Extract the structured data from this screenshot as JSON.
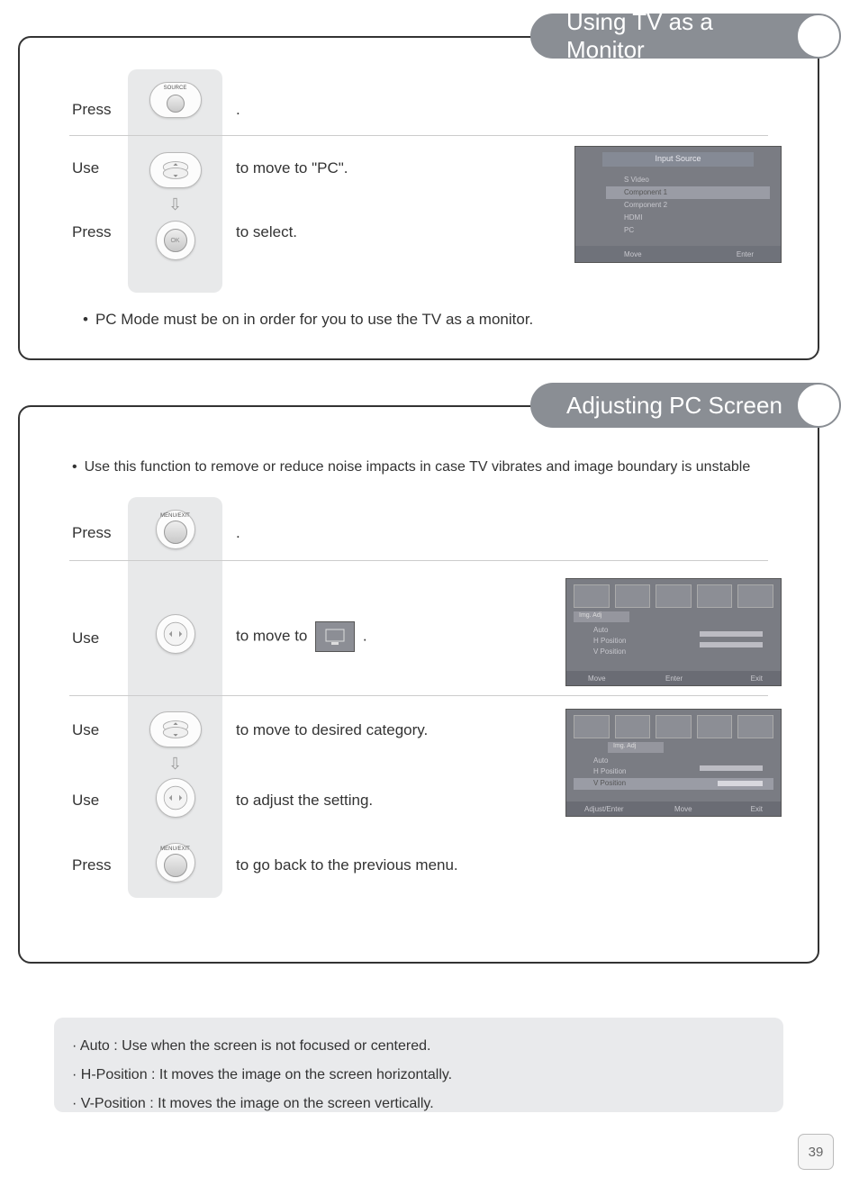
{
  "sections": {
    "s1": {
      "title": "Using TV as a Monitor",
      "rows": {
        "r1": {
          "action": "Press",
          "desc": ".",
          "button_label": "SOURCE"
        },
        "r2a": {
          "action": "Use",
          "desc": "to move to  \"PC\"."
        },
        "r2b": {
          "action": "Press",
          "desc": "to select.",
          "button_label": "OK"
        }
      },
      "note": "PC Mode must be on in order for you to use the TV as a monitor.",
      "osd": {
        "title": "Input Source",
        "items": [
          "S Video",
          "Component 1",
          "Component 2",
          "HDMI",
          "PC"
        ],
        "footer_left": "Move",
        "footer_right": "Enter"
      }
    },
    "s2": {
      "title": "Adjusting PC Screen",
      "intro": "Use this function to remove or reduce noise impacts in case TV vibrates and image boundary is unstable",
      "rows": {
        "r1": {
          "action": "Press",
          "desc": ".",
          "button_label": "MENU/EXIT"
        },
        "r2": {
          "action": "Use",
          "desc_pre": "to move to",
          "desc_post": "."
        },
        "r3": {
          "action": "Use",
          "desc": "to move to desired category."
        },
        "r4": {
          "action": "Use",
          "desc": "to adjust the setting."
        },
        "r5": {
          "action": "Press",
          "desc": "to go back to the previous menu.",
          "button_label": "MENU/EXIT"
        }
      },
      "osd1": {
        "tab": "Img. Adj",
        "items": [
          "Auto",
          "H Position",
          "V Position"
        ],
        "footer": [
          "Move",
          "Enter",
          "Exit"
        ]
      },
      "osd2": {
        "tab": "Img. Adj",
        "items": [
          "Auto",
          "H Position",
          "V Position"
        ],
        "footer": [
          "Adjust/Enter",
          "Move",
          "Exit"
        ]
      }
    }
  },
  "definitions": {
    "d1": "Auto : Use when the screen is not focused or centered.",
    "d2": "H-Position : It moves the image on the screen horizontally.",
    "d3": "V-Position : It moves the image on the screen vertically."
  },
  "page_number": "39"
}
